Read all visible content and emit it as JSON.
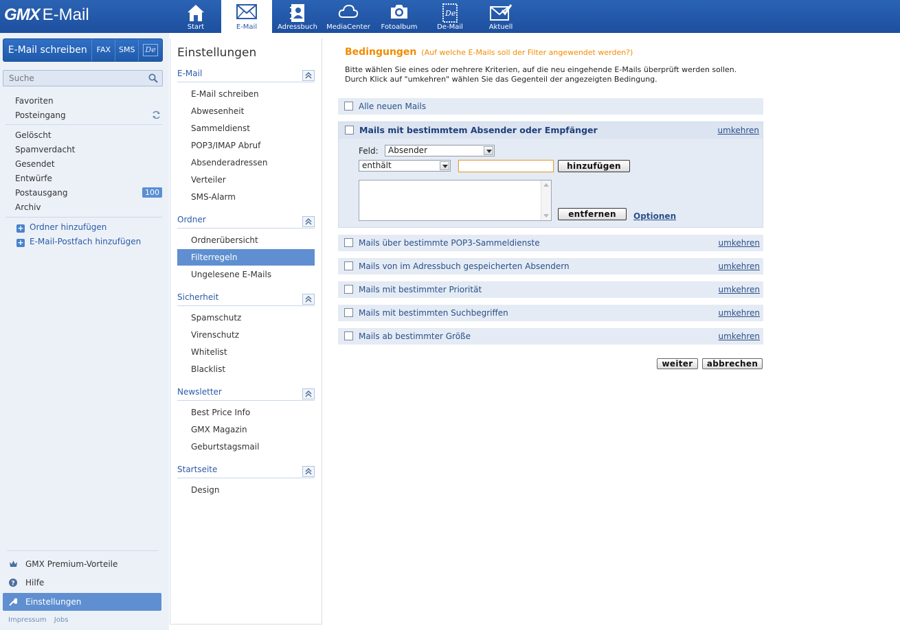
{
  "app": {
    "brand": "GMX",
    "name": "E-Mail"
  },
  "nav": [
    {
      "label": "Start",
      "icon": "home-icon"
    },
    {
      "label": "E-Mail",
      "icon": "envelope-icon",
      "active": true
    },
    {
      "label": "Adressbuch",
      "icon": "addressbook-icon"
    },
    {
      "label": "MediaCenter",
      "icon": "cloud-icon"
    },
    {
      "label": "Fotoalbum",
      "icon": "camera-icon"
    },
    {
      "label": "De-Mail",
      "icon": "de-mail-icon"
    },
    {
      "label": "Aktuell",
      "icon": "news-envelope-icon"
    }
  ],
  "sidebar": {
    "compose_label": "E-Mail schreiben",
    "fax_label": "FAX",
    "sms_label": "SMS",
    "de_label": "De",
    "search_placeholder": "Suche",
    "folders": [
      {
        "label": "Favoriten"
      },
      {
        "label": "Posteingang"
      },
      {
        "label": "Gelöscht"
      },
      {
        "label": "Spamverdacht"
      },
      {
        "label": "Gesendet"
      },
      {
        "label": "Entwürfe"
      },
      {
        "label": "Postausgang",
        "badge": "100"
      },
      {
        "label": "Archiv"
      }
    ],
    "add_folder": "Ordner hinzufügen",
    "add_mailbox": "E-Mail-Postfach hinzufügen",
    "premium": "GMX Premium-Vorteile",
    "help": "Hilfe",
    "settings": "Einstellungen",
    "footer": {
      "impressum": "Impressum",
      "jobs": "Jobs"
    }
  },
  "settings": {
    "title": "Einstellungen",
    "sections": [
      {
        "title": "E-Mail",
        "items": [
          "E-Mail schreiben",
          "Abwesenheit",
          "Sammeldienst",
          "POP3/IMAP Abruf",
          "Absenderadressen",
          "Verteiler",
          "SMS-Alarm"
        ]
      },
      {
        "title": "Ordner",
        "items": [
          "Ordnerübersicht",
          "Filterregeln",
          "Ungelesene E-Mails"
        ]
      },
      {
        "title": "Sicherheit",
        "items": [
          "Spamschutz",
          "Virenschutz",
          "Whitelist",
          "Blacklist"
        ]
      },
      {
        "title": "Newsletter",
        "items": [
          "Best Price Info",
          "GMX Magazin",
          "Geburtstagsmail"
        ]
      },
      {
        "title": "Startseite",
        "items": [
          "Design"
        ]
      }
    ],
    "active_item": "Filterregeln"
  },
  "main": {
    "title": "Bedingungen",
    "subtitle": "(Auf welche E-Mails soll der Filter angewendet werden?)",
    "intro_line1": "Bitte wählen Sie eines oder mehrere Kriterien, auf die neu eingehende E-Mails überprüft werden sollen.",
    "intro_line2": "Durch Klick auf \"umkehren\" wählen Sie das Gegenteil der angezeigten Bedingung.",
    "invert_label": "umkehren",
    "conditions": [
      {
        "label": "Alle neuen Mails",
        "checked": false,
        "invertible": false
      },
      {
        "label": "Mails mit bestimmtem Absender oder Empfänger",
        "checked": true,
        "invertible": true
      },
      {
        "label": "Mails über bestimmte POP3-Sammeldienste",
        "checked": false,
        "invertible": true
      },
      {
        "label": "Mails von im Adressbuch gespeicherten Absendern",
        "checked": false,
        "invertible": true
      },
      {
        "label": "Mails mit bestimmter Priorität",
        "checked": false,
        "invertible": true
      },
      {
        "label": "Mails mit bestimmten Suchbegriffen",
        "checked": false,
        "invertible": true
      },
      {
        "label": "Mails ab bestimmter Größe",
        "checked": false,
        "invertible": true
      }
    ],
    "filter": {
      "field_label": "Feld:",
      "field_value": "Absender",
      "operator_value": "enthält",
      "text_value": "",
      "add_button": "hinzufügen",
      "remove_button": "entfernen",
      "options_link": "Optionen"
    },
    "next_button": "weiter",
    "cancel_button": "abbrechen"
  },
  "colors": {
    "topbar": "#1d4f9e",
    "accent": "#f08c00",
    "active": "#5f8fd0"
  }
}
